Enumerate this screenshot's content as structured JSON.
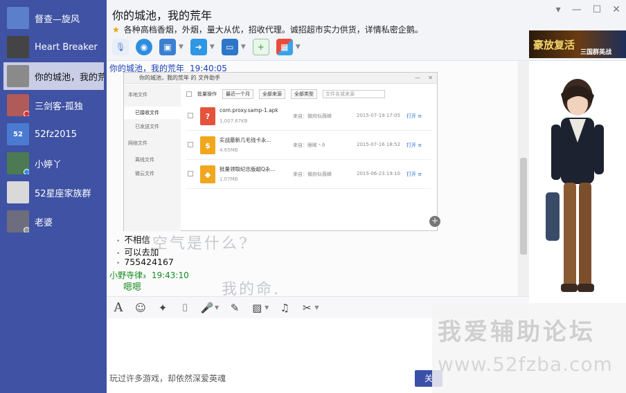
{
  "sidebar": {
    "contacts": [
      {
        "name": "督查—旋风",
        "avatar_color": "#5b7fc9",
        "badge": "",
        "active": false
      },
      {
        "name": "Heart Breaker",
        "avatar_color": "#444444",
        "badge": "",
        "active": false
      },
      {
        "name": "你的城池，我的荒",
        "avatar_color": "#8a8a8a",
        "badge": "",
        "active": true
      },
      {
        "name": "三剑客-孤独",
        "avatar_color": "#b05a5a",
        "badge": "#d33",
        "active": false
      },
      {
        "name": "52fz2015",
        "avatar_color": "#4a7bd1",
        "avatar_text": "52",
        "badge": "",
        "active": false
      },
      {
        "name": "小婷丫",
        "avatar_color": "#4d7a52",
        "badge": "#3a8ee6",
        "active": false
      },
      {
        "name": "52星座家族群",
        "avatar_color": "#d9d9d9",
        "badge": "",
        "active": false
      },
      {
        "name": "老婆",
        "avatar_color": "#6d6d7d",
        "badge": "#999",
        "active": false
      }
    ]
  },
  "header": {
    "title": "你的城池，我的荒年",
    "notice": "各种高档香烟，外烟，量大从优，招收代理。诚招超市实力供货，详情私密企鹅。",
    "window_buttons": {
      "dropdown": "▾",
      "minimize": "—",
      "maximize": "☐",
      "close": "✕"
    }
  },
  "toolbar_icons": [
    "microphone-icon",
    "video-call-icon",
    "screen-share-icon",
    "file-transfer-icon",
    "remote-desktop-icon",
    "add-app-icon",
    "apps-grid-icon"
  ],
  "chat": {
    "message1": {
      "sender": "你的城池，我的荒年",
      "time": "19:40:05"
    },
    "screenshot": {
      "title": "你的城池，我的荒年 的 文件助手",
      "sidebar": {
        "local_label": "本地文件",
        "received": "已接收文件",
        "sent": "已发送文件",
        "online_label": "网络文件",
        "offline": "离线文件",
        "cloud": "微云文件"
      },
      "toolbar": {
        "batch": "批量操作",
        "period": "最近一个月",
        "source": "全部来源",
        "type": "全部类型",
        "search_placeholder": "文件名或来源"
      },
      "files": [
        {
          "name": "com.proxy.samp-1.apk",
          "size": "1,007.67KB",
          "from": "来自：微府似薇峰",
          "date": "2015-07-19 17:05",
          "action": "打开",
          "icon": "?",
          "color": "#e5533c"
        },
        {
          "name": "实战最新几毛钱卡永...",
          "size": "4.65MB",
          "from": "来自：眼眸丶ð",
          "date": "2015-07-16 18:52",
          "action": "打开",
          "icon": "$",
          "color": "#f0a71e"
        },
        {
          "name": "批量领取纪念版超Q永...",
          "size": "1.07MB",
          "from": "来自：微府似薇峰",
          "date": "2015-06-23 19:10",
          "action": "打开",
          "icon": "◆",
          "color": "#f0a71e"
        }
      ]
    },
    "lines": [
      "不相信",
      "可以去加",
      "755424167"
    ],
    "message2": {
      "sender": "小野寺律₃",
      "time": "19:43:10"
    },
    "reply": "嗯嗯",
    "bg_text_1": "空气是什么?",
    "bg_text_2": "我的命."
  },
  "ad": {
    "title": "豪放复活",
    "subtitle": "三国群英战"
  },
  "input": {
    "placeholder": "玩过许多游戏，却依然深爱英魂",
    "send_label": "关"
  },
  "input_toolbar": [
    "font-icon",
    "emoji-icon",
    "magic-icon",
    "screenshot-icon",
    "voice-icon",
    "edit-icon",
    "image-icon",
    "music-icon",
    "scissors-icon"
  ],
  "watermark": {
    "text": "我爱辅助论坛",
    "url": "www.52fzba.com"
  }
}
